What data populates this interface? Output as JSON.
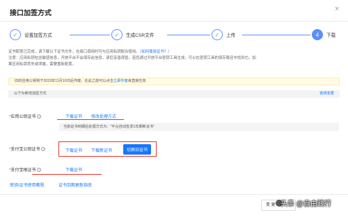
{
  "dialog": {
    "title": "接口加签方式",
    "close_glyph": "×"
  },
  "steps": [
    {
      "label": "设置加签方式",
      "mark": "✓"
    },
    {
      "label": "生成CSR文件",
      "mark": "✓"
    },
    {
      "label": "上传",
      "mark": "✓"
    },
    {
      "label": "下载",
      "mark": "4"
    }
  ],
  "notice": {
    "line1": "证书配置已完成，请下载以下证书文件，在接口调用时可与应用私钥配合使用。",
    "line1_link": "（如何使用证书？）",
    "line2": "注意：应用私钥包含敏感信息，开放平台不会保存此信息，请您妥善保管。若您通过开放平台密钥工具生成，可以在密钥工具的保存路径中找到它。如",
    "line3": "果应用私钥丢失或泄露，需要重新配置。"
  },
  "yellow_banner": {
    "text": "旧的应用公钥将于2023年11月10日后作废，在此之前可以点击",
    "link": "立即作废",
    "suffix": "来直接生效"
  },
  "grey_bar": {
    "text": "以下为新增加签方式",
    "right_link": "密钥变更"
  },
  "rows": {
    "app_cert": {
      "label": "应用公钥证书",
      "download": "下载证书",
      "modify": "修改处理方式",
      "info": "当前证书到期后处理方式为：\"平台自动签发1年期新证书\""
    },
    "alipay_cert": {
      "label": "支付宝公钥证书",
      "download": "下载证书",
      "download_new": "下载新证书",
      "switch": "切换旧证书"
    },
    "root_cert": {
      "label": "支付宝根证书",
      "download": "下载证书"
    }
  },
  "bottom_links": {
    "guide": "密钥/证书使用教程",
    "renew": "证书到期更新指南"
  },
  "footer": {
    "button": "变 更"
  },
  "watermark": {
    "text": "头条 @自由践行"
  },
  "colors": {
    "accent": "#1677ff",
    "step": "#5b8ff9",
    "highlight_red": "#e8312a"
  },
  "icons": {
    "help": "question-circle-icon",
    "close": "close-icon",
    "step_done": "check-icon"
  }
}
